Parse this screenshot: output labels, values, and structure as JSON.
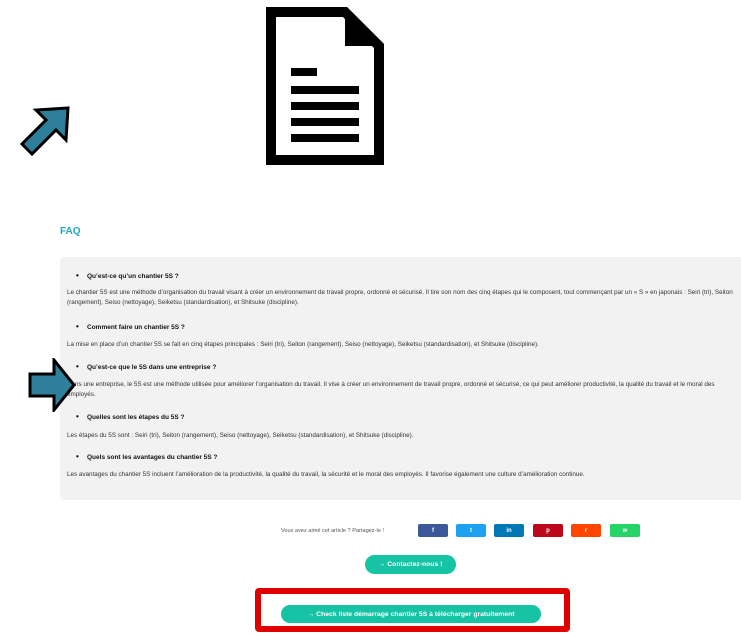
{
  "faq": {
    "title": "FAQ",
    "items": [
      {
        "question": "Qu’est-ce qu’un chantier 5S ?",
        "answer": "Le chantier 5S est une méthode d’organisation du travail visant à créer un environnement de travail propre, ordonné et sécurisé. Il tire son nom des cinq étapes qui le composent, tout commençant par un « S » en japonais : Seiri (tri), Seiton (rangement), Seiso (nettoyage), Seiketsu (standardisation), et Shitsuke (discipline)."
      },
      {
        "question": "Comment faire un chantier 5S ?",
        "answer": "La mise en place d’un chantier 5S se fait en cinq étapes principales : Seiri (tri), Seiton (rangement), Seiso (nettoyage), Seiketsu (standardisation), et Shitsuke (discipline)."
      },
      {
        "question": "Qu’est-ce que le 5S dans une entreprise ?",
        "answer": "Dans une entreprise, le 5S est une méthode utilisée pour améliorer l’organisation du travail. Il vise à créer un environnement de travail propre, ordonné et sécurisé, ce qui peut améliorer productivité, la qualité du travail et le moral des employés."
      },
      {
        "question": "Quelles sont les étapes du 5S ?",
        "answer": "Les étapes du 5S sont : Seiri (tri), Seiton (rangement), Seiso (nettoyage), Seiketsu (standardisation), et Shitsuke (discipline)."
      },
      {
        "question": "Quels sont les avantages du chantier 5S ?",
        "answer": "Les avantages du chantier 5S incluent l’amélioration de la productivité, la qualité du travail, la sécurité et le moral des employés. Il favorise également une culture d’amélioration continue."
      }
    ]
  },
  "share": {
    "label": "Vous avez aimé cet article ? Partagez-le !",
    "buttons": [
      {
        "network": "facebook",
        "icon": "facebook-icon",
        "glyph": "f",
        "color": "#3b5998"
      },
      {
        "network": "twitter",
        "icon": "twitter-icon",
        "glyph": "t",
        "color": "#1da1f2"
      },
      {
        "network": "linkedin",
        "icon": "linkedin-icon",
        "glyph": "in",
        "color": "#0077b5"
      },
      {
        "network": "pinterest",
        "icon": "pinterest-icon",
        "glyph": "p",
        "color": "#bd081c"
      },
      {
        "network": "reddit",
        "icon": "reddit-icon",
        "glyph": "r",
        "color": "#ff4500"
      },
      {
        "network": "whatsapp",
        "icon": "whatsapp-icon",
        "glyph": "w",
        "color": "#25d366"
      }
    ]
  },
  "cta": {
    "contact_label": "→ Contactez-nous !",
    "download_label": "→ Check liste démarrage chantier 5S à télécharger gratuitement"
  },
  "colors": {
    "accent": "#1fa8bd",
    "button": "#17c3a5",
    "highlight": "#e00000",
    "arrow": "#2e7f99"
  }
}
